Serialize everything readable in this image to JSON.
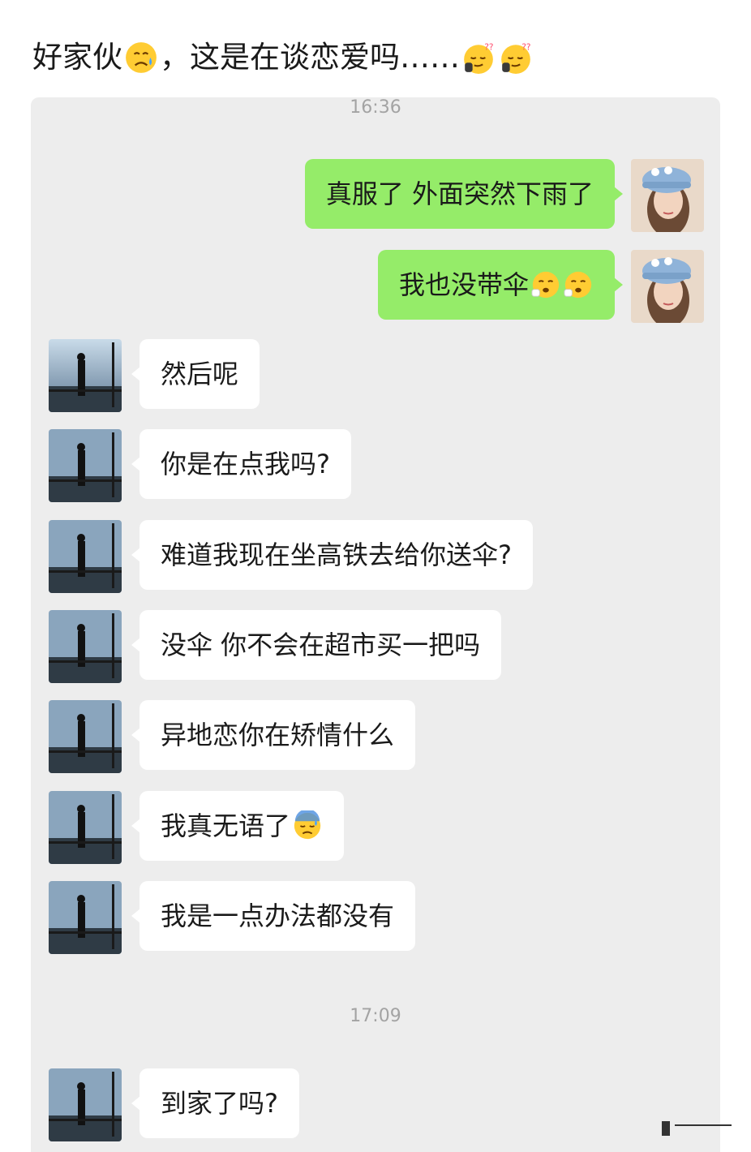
{
  "post": {
    "title_prefix": "好家伙",
    "title_middle": "，这是在谈恋爱吗……",
    "title_emojis": [
      "sad-sweat-emoji",
      "sleepy-thinking-emoji",
      "sleepy-thinking-emoji"
    ]
  },
  "chat": {
    "timestamps": [
      "16:36",
      "17:09"
    ],
    "outgoing": [
      {
        "text": "真服了 外面突然下雨了",
        "emojis": []
      },
      {
        "text": "我也没带伞",
        "emojis": [
          "crying-face-emoji",
          "crying-face-emoji"
        ]
      }
    ],
    "incoming": [
      {
        "text": "然后呢",
        "emojis": []
      },
      {
        "text": "你是在点我吗?",
        "emojis": []
      },
      {
        "text": "难道我现在坐高铁去给你送伞?",
        "emojis": []
      },
      {
        "text": "没伞 你不会在超市买一把吗",
        "emojis": []
      },
      {
        "text": "异地恋你在矫情什么",
        "emojis": []
      },
      {
        "text": "我真无语了",
        "emojis": [
          "downcast-sweat-emoji"
        ]
      },
      {
        "text": "我是一点办法都没有",
        "emojis": []
      }
    ],
    "after_break": [
      {
        "text": "到家了吗?",
        "emojis": []
      }
    ]
  },
  "colors": {
    "outgoing_bubble": "#95ec69",
    "incoming_bubble": "#ffffff",
    "chat_background": "#ededed"
  }
}
